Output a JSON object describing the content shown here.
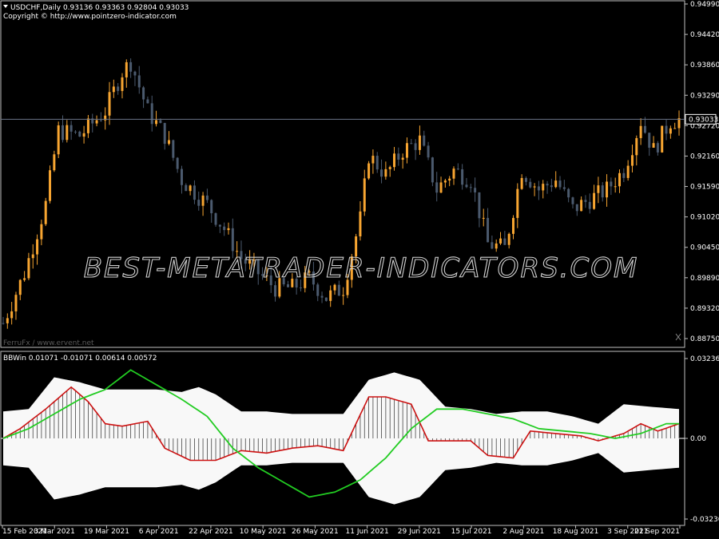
{
  "header": {
    "symbol_line": "USDCHF,Daily  0.93136 0.93363 0.92804 0.93033",
    "copyright": "Copyright © http://www.pointzero-indicator.com",
    "credit": "FerruFx / www.ervent.net",
    "watermark": "BEST-METATRADER-INDICATORS.COM",
    "indicator_line": "BBWin 0.01071 -0.01071 0.00614 0.00572"
  },
  "colors": {
    "background": "#000000",
    "bull_candle": "#f7a531",
    "bear_candle": "#4b5a6e",
    "price_line": "#6c7689",
    "band_fill": "#f8f8f8",
    "histogram_line": "#cc1111",
    "signal_line": "#22cc22"
  },
  "current_price_tag": "0.93033",
  "chart_data": [
    {
      "type": "candlestick",
      "title": "USDCHF,Daily",
      "ylim": [
        0.885,
        0.953
      ],
      "y_ticks": [
        "0.94990",
        "0.94420",
        "0.93860",
        "0.93290",
        "0.92720",
        "0.92160",
        "0.91590",
        "0.91020",
        "0.90450",
        "0.89890",
        "0.89320",
        "0.88750"
      ],
      "current_price": 0.93033,
      "x_ticks": [
        "15 Feb 2021",
        "3 Mar 2021",
        "19 Mar 2021",
        "6 Apr 2021",
        "22 Apr 2021",
        "10 May 2021",
        "26 May 2021",
        "11 Jun 2021",
        "29 Jun 2021",
        "15 Jul 2021",
        "2 Aug 2021",
        "18 Aug 2021",
        "3 Sep 2021",
        "21 Sep 2021"
      ],
      "close_path": [
        [
          0,
          0.8888
        ],
        [
          5,
          0.899
        ],
        [
          10,
          0.913
        ],
        [
          13,
          0.928
        ],
        [
          18,
          0.927
        ],
        [
          24,
          0.932
        ],
        [
          28,
          0.94
        ],
        [
          30,
          0.942
        ],
        [
          34,
          0.932
        ],
        [
          38,
          0.927
        ],
        [
          42,
          0.918
        ],
        [
          48,
          0.913
        ],
        [
          52,
          0.908
        ],
        [
          56,
          0.902
        ],
        [
          60,
          0.899
        ],
        [
          64,
          0.896
        ],
        [
          68,
          0.896
        ],
        [
          72,
          0.898
        ],
        [
          76,
          0.894
        ],
        [
          80,
          0.896
        ],
        [
          84,
          0.91
        ],
        [
          86,
          0.923
        ],
        [
          90,
          0.919
        ],
        [
          94,
          0.924
        ],
        [
          98,
          0.926
        ],
        [
          102,
          0.916
        ],
        [
          106,
          0.92
        ],
        [
          110,
          0.918
        ],
        [
          114,
          0.905
        ],
        [
          118,
          0.904
        ],
        [
          122,
          0.92
        ],
        [
          126,
          0.916
        ],
        [
          130,
          0.918
        ],
        [
          134,
          0.912
        ],
        [
          138,
          0.914
        ],
        [
          142,
          0.916
        ],
        [
          146,
          0.92
        ],
        [
          150,
          0.93
        ],
        [
          153,
          0.924
        ],
        [
          157,
          0.93
        ],
        [
          159,
          0.9303
        ]
      ]
    },
    {
      "type": "line",
      "title": "BBWin",
      "ylim": [
        -0.03236,
        0.03236
      ],
      "y_ticks": [
        "0.03236",
        "0.00",
        "-0.03236"
      ],
      "values_shown": [
        0.01071,
        -0.01071,
        0.00614,
        0.00572
      ],
      "series": [
        {
          "role": "histogram",
          "points": [
            [
              0,
              0.0
            ],
            [
              4,
              0.004
            ],
            [
              10,
              0.012
            ],
            [
              16,
              0.021
            ],
            [
              20,
              0.015
            ],
            [
              24,
              0.006
            ],
            [
              28,
              0.005
            ],
            [
              34,
              0.007
            ],
            [
              38,
              -0.004
            ],
            [
              44,
              -0.009
            ],
            [
              50,
              -0.009
            ],
            [
              56,
              -0.005
            ],
            [
              62,
              -0.006
            ],
            [
              68,
              -0.004
            ],
            [
              74,
              -0.003
            ],
            [
              80,
              -0.005
            ],
            [
              86,
              0.017
            ],
            [
              90,
              0.017
            ],
            [
              96,
              0.014
            ],
            [
              100,
              -0.001
            ],
            [
              106,
              -0.001
            ],
            [
              110,
              -0.001
            ],
            [
              114,
              -0.007
            ],
            [
              120,
              -0.008
            ],
            [
              124,
              0.003
            ],
            [
              130,
              0.002
            ],
            [
              136,
              0.001
            ],
            [
              140,
              -0.001
            ],
            [
              146,
              0.002
            ],
            [
              150,
              0.006
            ],
            [
              154,
              0.003
            ],
            [
              159,
              0.006
            ]
          ]
        },
        {
          "role": "upper band",
          "points": [
            [
              0,
              0.011
            ],
            [
              6,
              0.012
            ],
            [
              12,
              0.025
            ],
            [
              18,
              0.023
            ],
            [
              24,
              0.02
            ],
            [
              30,
              0.02
            ],
            [
              36,
              0.02
            ],
            [
              42,
              0.019
            ],
            [
              46,
              0.021
            ],
            [
              50,
              0.018
            ],
            [
              56,
              0.011
            ],
            [
              62,
              0.011
            ],
            [
              68,
              0.01
            ],
            [
              74,
              0.01
            ],
            [
              80,
              0.01
            ],
            [
              86,
              0.024
            ],
            [
              92,
              0.027
            ],
            [
              98,
              0.024
            ],
            [
              104,
              0.013
            ],
            [
              110,
              0.012
            ],
            [
              116,
              0.01
            ],
            [
              122,
              0.011
            ],
            [
              128,
              0.011
            ],
            [
              134,
              0.009
            ],
            [
              140,
              0.006
            ],
            [
              146,
              0.014
            ],
            [
              152,
              0.013
            ],
            [
              159,
              0.012
            ]
          ]
        },
        {
          "role": "lower band",
          "points": [
            [
              0,
              -0.011
            ],
            [
              6,
              -0.012
            ],
            [
              12,
              -0.025
            ],
            [
              18,
              -0.023
            ],
            [
              24,
              -0.02
            ],
            [
              30,
              -0.02
            ],
            [
              36,
              -0.02
            ],
            [
              42,
              -0.019
            ],
            [
              46,
              -0.021
            ],
            [
              50,
              -0.018
            ],
            [
              56,
              -0.011
            ],
            [
              62,
              -0.011
            ],
            [
              68,
              -0.01
            ],
            [
              74,
              -0.01
            ],
            [
              80,
              -0.01
            ],
            [
              86,
              -0.024
            ],
            [
              92,
              -0.027
            ],
            [
              98,
              -0.024
            ],
            [
              104,
              -0.013
            ],
            [
              110,
              -0.012
            ],
            [
              116,
              -0.01
            ],
            [
              122,
              -0.011
            ],
            [
              128,
              -0.011
            ],
            [
              134,
              -0.009
            ],
            [
              140,
              -0.006
            ],
            [
              146,
              -0.014
            ],
            [
              152,
              -0.013
            ],
            [
              159,
              -0.012
            ]
          ]
        },
        {
          "role": "signal",
          "points": [
            [
              0,
              0.0
            ],
            [
              6,
              0.004
            ],
            [
              12,
              0.01
            ],
            [
              18,
              0.016
            ],
            [
              24,
              0.02
            ],
            [
              30,
              0.028
            ],
            [
              36,
              0.022
            ],
            [
              42,
              0.016
            ],
            [
              48,
              0.009
            ],
            [
              54,
              -0.004
            ],
            [
              60,
              -0.012
            ],
            [
              66,
              -0.018
            ],
            [
              72,
              -0.024
            ],
            [
              78,
              -0.022
            ],
            [
              84,
              -0.017
            ],
            [
              90,
              -0.008
            ],
            [
              96,
              0.004
            ],
            [
              102,
              0.012
            ],
            [
              108,
              0.012
            ],
            [
              114,
              0.01
            ],
            [
              120,
              0.008
            ],
            [
              126,
              0.004
            ],
            [
              132,
              0.003
            ],
            [
              138,
              0.002
            ],
            [
              144,
              0.0
            ],
            [
              150,
              0.002
            ],
            [
              156,
              0.006
            ],
            [
              159,
              0.006
            ]
          ]
        }
      ]
    }
  ]
}
